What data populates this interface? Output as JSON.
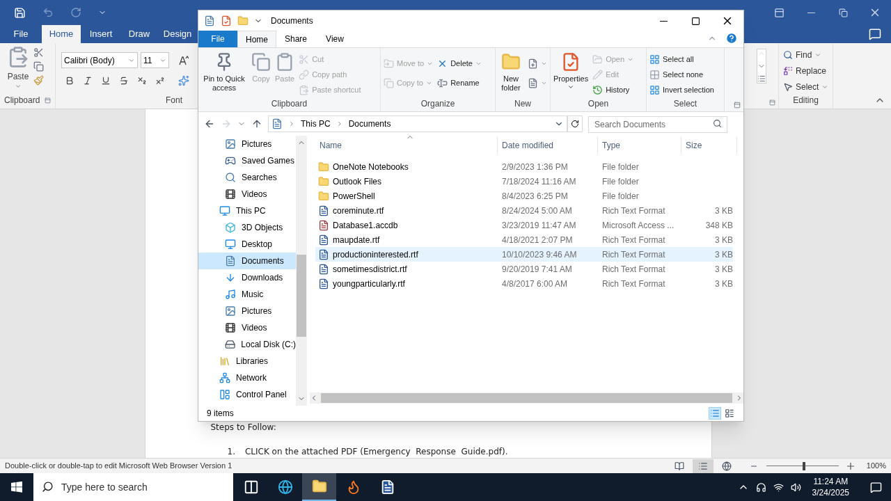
{
  "word": {
    "tabs": [
      {
        "label": "File",
        "selected": false
      },
      {
        "label": "Home",
        "selected": true
      },
      {
        "label": "Insert",
        "selected": false
      },
      {
        "label": "Draw",
        "selected": false
      },
      {
        "label": "Design",
        "selected": false
      }
    ],
    "ribbon": {
      "clipboard": {
        "paste": "Paste",
        "label": "Clipboard"
      },
      "font": {
        "font_name": "Calibri (Body)",
        "font_size": "11",
        "label": "Font",
        "format_buttons": [
          {
            "kind": "bold"
          },
          {
            "kind": "italic"
          },
          {
            "kind": "underline"
          },
          {
            "kind": "strike"
          },
          {
            "kind": "subscript"
          },
          {
            "kind": "superscript"
          }
        ]
      },
      "editing": {
        "label": "Editing",
        "items": [
          {
            "label": "Find",
            "kind": "find",
            "menu": true
          },
          {
            "label": "Replace",
            "kind": "replace",
            "menu": false
          },
          {
            "label": "Select",
            "kind": "select",
            "menu": true
          }
        ]
      }
    },
    "document": {
      "heading": "Steps to Follow:",
      "steps": [
        {
          "number": "1.",
          "text": "CLICK on the attached PDF (Emergency  Response  Guide.pdf)."
        }
      ]
    },
    "status_bar": {
      "text": "Double-click or double-tap to edit Microsoft Web Browser Version 1",
      "zoom": {
        "level": 0.5,
        "reading": "100%"
      }
    }
  },
  "explorer": {
    "title": "Documents",
    "tabs": [
      {
        "label": "File",
        "kind": "file",
        "selected": false
      },
      {
        "label": "Home",
        "kind": "tab",
        "selected": true
      },
      {
        "label": "Share",
        "kind": "tab",
        "selected": false
      },
      {
        "label": "View",
        "kind": "tab",
        "selected": false
      }
    ],
    "ribbon": {
      "groups": [
        {
          "label": "Clipboard",
          "large": [
            {
              "label": "Pin to Quick access",
              "kind": "pin",
              "disabled": false,
              "menu": false
            },
            {
              "label": "Copy",
              "kind": "copy",
              "disabled": true,
              "menu": false
            },
            {
              "label": "Paste",
              "kind": "paste",
              "disabled": true,
              "menu": false
            }
          ],
          "columns": [
            [
              {
                "label": "Cut",
                "kind": "cut",
                "disabled": true,
                "menu": false
              },
              {
                "label": "Copy path",
                "kind": "copy-path",
                "disabled": true,
                "menu": false
              },
              {
                "label": "Paste shortcut",
                "kind": "shortcut",
                "disabled": true,
                "menu": false
              }
            ]
          ]
        },
        {
          "label": "Organize",
          "columns": [
            [
              {
                "label": "Move to",
                "kind": "move",
                "disabled": true,
                "menu": true
              },
              {
                "label": "Copy to",
                "kind": "copy",
                "disabled": true,
                "menu": true
              }
            ],
            [
              {
                "label": "Delete",
                "kind": "delete",
                "disabled": false,
                "menu": true
              },
              {
                "label": "Rename",
                "kind": "rename",
                "disabled": false,
                "menu": false
              }
            ]
          ]
        },
        {
          "label": "New",
          "large": [
            {
              "label": "New folder",
              "kind": "folder",
              "disabled": false,
              "menu": false
            }
          ],
          "columns": [
            [
              {
                "kind": "new-item",
                "disabled": false,
                "menu": true
              },
              {
                "kind": "easy-access",
                "disabled": false,
                "menu": true
              }
            ]
          ]
        },
        {
          "label": "Open",
          "large": [
            {
              "label": "Properties",
              "kind": "properties",
              "disabled": false,
              "menu": true
            }
          ],
          "columns": [
            [
              {
                "label": "Open",
                "kind": "open",
                "disabled": true,
                "menu": true
              },
              {
                "label": "Edit",
                "kind": "edit",
                "disabled": true,
                "menu": false
              },
              {
                "label": "History",
                "kind": "history",
                "disabled": false,
                "menu": false
              }
            ]
          ]
        },
        {
          "label": "Select",
          "columns": [
            [
              {
                "label": "Select all",
                "kind": "select-all",
                "disabled": false,
                "menu": false
              },
              {
                "label": "Select none",
                "kind": "select-none",
                "disabled": false,
                "menu": false
              },
              {
                "label": "Invert selection",
                "kind": "invert",
                "disabled": false,
                "menu": false
              }
            ]
          ]
        }
      ]
    },
    "address": {
      "path": [
        "This PC",
        "Documents"
      ],
      "search_placeholder": "Search Documents"
    },
    "nav_pane": {
      "children_of_scrolled_item": [
        {
          "label": "Pictures",
          "kind": "pictures",
          "selected": false
        },
        {
          "label": "Saved Games",
          "kind": "games",
          "selected": false
        },
        {
          "label": "Searches",
          "kind": "search",
          "selected": false
        },
        {
          "label": "Videos",
          "kind": "videos",
          "selected": false
        }
      ],
      "items": [
        {
          "label": "This PC",
          "kind": "pc",
          "selected": false,
          "children": [
            {
              "label": "3D Objects",
              "kind": "cube",
              "selected": false
            },
            {
              "label": "Desktop",
              "kind": "desktop",
              "selected": false
            },
            {
              "label": "Documents",
              "kind": "documents",
              "selected": true
            },
            {
              "label": "Downloads",
              "kind": "downloads",
              "selected": false
            },
            {
              "label": "Music",
              "kind": "music",
              "selected": false
            },
            {
              "label": "Pictures",
              "kind": "pictures",
              "selected": false
            },
            {
              "label": "Videos",
              "kind": "videos",
              "selected": false
            },
            {
              "label": "Local Disk (C:)",
              "kind": "disk",
              "selected": false
            }
          ]
        },
        {
          "label": "Libraries",
          "kind": "libraries",
          "selected": false
        },
        {
          "label": "Network",
          "kind": "network",
          "selected": false
        },
        {
          "label": "Control Panel",
          "kind": "control-panel",
          "selected": false
        }
      ]
    },
    "columns": [
      "Name",
      "Date modified",
      "Type",
      "Size"
    ],
    "files": [
      {
        "name": "OneNote Notebooks",
        "kind": "folder",
        "date": "2/9/2023 1:36 PM",
        "type": "File folder",
        "selected": false
      },
      {
        "name": "Outlook Files",
        "kind": "folder",
        "date": "7/18/2024 11:16 AM",
        "type": "File folder",
        "selected": false
      },
      {
        "name": "PowerShell",
        "kind": "folder",
        "date": "8/4/2023 6:25 PM",
        "type": "File folder",
        "selected": false
      },
      {
        "name": "coreminute.rtf",
        "kind": "word",
        "date": "8/24/2024 5:00 AM",
        "type": "Rich Text Format",
        "size": "3 KB",
        "selected": false
      },
      {
        "name": "Database1.accdb",
        "kind": "access",
        "date": "3/23/2019 11:47 AM",
        "type": "Microsoft Access ...",
        "size": "348 KB",
        "selected": false
      },
      {
        "name": "maupdate.rtf",
        "kind": "word",
        "date": "4/18/2021 2:07 PM",
        "type": "Rich Text Format",
        "size": "3 KB",
        "selected": false
      },
      {
        "name": "productioninterested.rtf",
        "kind": "word",
        "date": "10/10/2023 9:46 AM",
        "type": "Rich Text Format",
        "size": "3 KB",
        "selected": true
      },
      {
        "name": "sometimesdistrict.rtf",
        "kind": "word",
        "date": "9/20/2019 7:41 AM",
        "type": "Rich Text Format",
        "size": "3 KB",
        "selected": false
      },
      {
        "name": "youngparticularly.rtf",
        "kind": "word",
        "date": "4/8/2017 6:00 AM",
        "type": "Rich Text Format",
        "size": "3 KB",
        "selected": false
      }
    ],
    "status": "9 items"
  },
  "taskbar": {
    "search_placeholder": "Type here to search",
    "apps": [
      {
        "kind": "task-view",
        "selected": false
      },
      {
        "kind": "browser",
        "selected": false
      },
      {
        "kind": "explorer",
        "selected": true
      },
      {
        "kind": "firefox",
        "selected": false
      },
      {
        "kind": "word",
        "selected": false
      }
    ],
    "time": "11:24 AM",
    "date": "3/24/2025"
  }
}
